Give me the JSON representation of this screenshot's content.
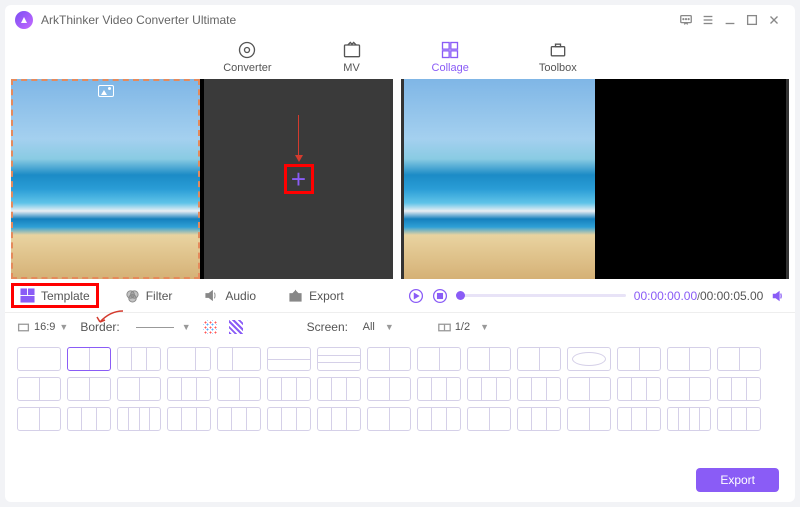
{
  "app": {
    "title": "ArkThinker Video Converter Ultimate"
  },
  "nav": {
    "items": [
      {
        "label": "Converter"
      },
      {
        "label": "MV"
      },
      {
        "label": "Collage"
      },
      {
        "label": "Toolbox"
      }
    ],
    "active": 2
  },
  "tabs": {
    "items": [
      {
        "label": "Template"
      },
      {
        "label": "Filter"
      },
      {
        "label": "Audio"
      },
      {
        "label": "Export"
      }
    ],
    "active": 0
  },
  "player": {
    "current": "00:00:00.00",
    "total": "00:00:05.00"
  },
  "controls": {
    "ratio": "16:9",
    "border_label": "Border:",
    "screen_label": "Screen:",
    "screen_value": "All",
    "split_value": "1/2"
  },
  "footer": {
    "export": "Export"
  }
}
